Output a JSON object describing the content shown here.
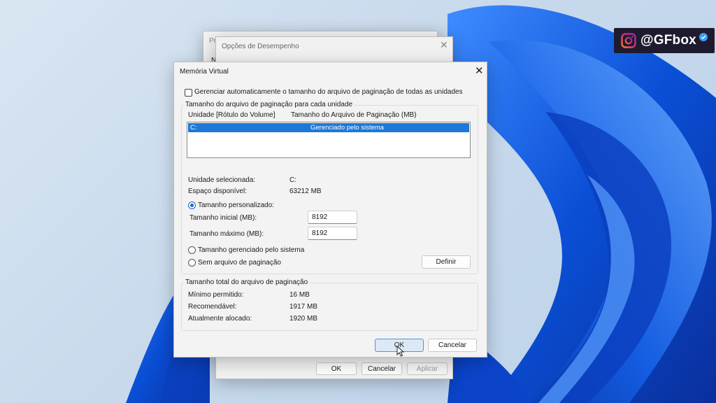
{
  "watermark": {
    "handle": "@GFbox",
    "brand_colors": [
      "#f58529",
      "#dd2a7b",
      "#8134af"
    ]
  },
  "back_window_2": {
    "title": "Pr",
    "row_label": "N"
  },
  "back_window_1": {
    "title": "Opções de Desempenho",
    "buttons": {
      "ok": "OK",
      "cancel": "Cancelar",
      "apply": "Aplicar"
    }
  },
  "dialog": {
    "title": "Memória Virtual",
    "auto_manage_label": "Gerenciar automaticamente o tamanho do arquivo de paginação de todas as unidades",
    "auto_manage_checked": false,
    "per_drive_group": {
      "legend": "Tamanho do arquivo de paginação para cada unidade",
      "columns": [
        "Unidade [Rótulo do Volume]",
        "Tamanho do Arquivo de Paginação (MB)"
      ],
      "rows": [
        {
          "drive": "C:",
          "size": "Gerenciado pelo sistema",
          "selected": true
        }
      ],
      "selected_drive_label": "Unidade selecionada:",
      "selected_drive_value": "C:",
      "free_space_label": "Espaço disponível:",
      "free_space_value": "63212 MB",
      "custom_size_label": "Tamanho personalizado:",
      "initial_size_label": "Tamanho inicial (MB):",
      "initial_size_value": "8192",
      "max_size_label": "Tamanho máximo (MB):",
      "max_size_value": "8192",
      "system_managed_label": "Tamanho gerenciado pelo sistema",
      "no_paging_label": "Sem arquivo de paginação",
      "selected_option": "custom",
      "set_button": "Definir"
    },
    "total_group": {
      "legend": "Tamanho total do arquivo de paginação",
      "min_label": "Mínimo permitido:",
      "min_value": "16 MB",
      "recommended_label": "Recomendável:",
      "recommended_value": "1917 MB",
      "allocated_label": "Atualmente alocado:",
      "allocated_value": "1920 MB"
    },
    "buttons": {
      "ok": "OK",
      "cancel": "Cancelar"
    },
    "close_glyph": "✕"
  },
  "accent_color": "#1e78d7"
}
